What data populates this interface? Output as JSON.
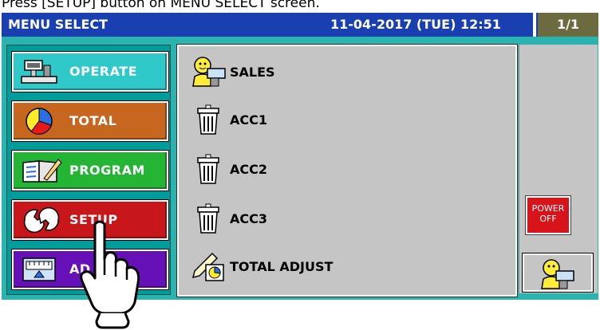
{
  "caption": "Press [SETUP] button on MENU SELECT screen.",
  "title": "MENU SELECT",
  "datetime": "11-04-2017 (TUE)  12:51",
  "page_indicator": "1/1",
  "menu": [
    {
      "label": "OPERATE",
      "icon": "operate-scale-icon",
      "color": "#2fc9c9"
    },
    {
      "label": "TOTAL",
      "icon": "pie-chart-icon",
      "color": "#c7661e"
    },
    {
      "label": "PROGRAM",
      "icon": "program-book-icon",
      "color": "#25b535"
    },
    {
      "label": "SETUP",
      "icon": "wrench-icon",
      "color": "#c8171b"
    },
    {
      "label": "AD",
      "icon": "adjust-scale-icon",
      "color": "#6610b8"
    }
  ],
  "items": [
    {
      "label": "SALES",
      "icon": "sales-clerk-icon"
    },
    {
      "label": "ACC1",
      "icon": "trash-can-icon"
    },
    {
      "label": "ACC2",
      "icon": "trash-can-icon"
    },
    {
      "label": "ACC3",
      "icon": "trash-can-icon"
    },
    {
      "label": "TOTAL ADJUST",
      "icon": "pencil-chart-icon"
    }
  ],
  "power": {
    "line1": "POWER",
    "line2": "OFF"
  },
  "colors": {
    "title_bar": "#1a3fb0",
    "screen_bg": "#2bb3b0",
    "panel_bg": "#c5c5c5",
    "power": "#d8141a"
  }
}
